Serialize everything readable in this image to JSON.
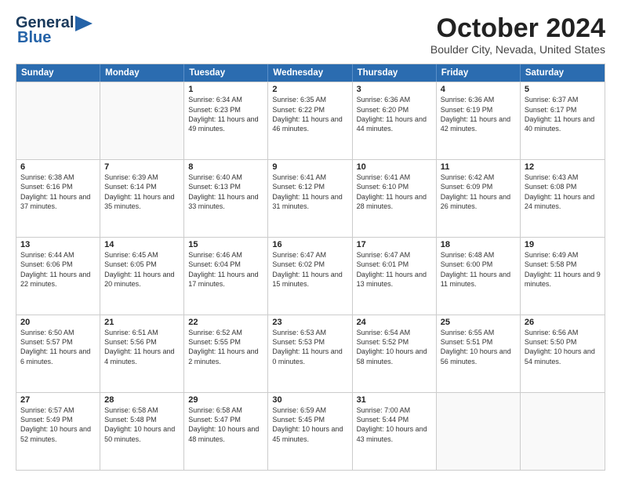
{
  "header": {
    "logo_line1": "General",
    "logo_line2": "Blue",
    "title": "October 2024",
    "location": "Boulder City, Nevada, United States"
  },
  "days_of_week": [
    "Sunday",
    "Monday",
    "Tuesday",
    "Wednesday",
    "Thursday",
    "Friday",
    "Saturday"
  ],
  "weeks": [
    [
      {
        "day": "",
        "sunrise": "",
        "sunset": "",
        "daylight": ""
      },
      {
        "day": "",
        "sunrise": "",
        "sunset": "",
        "daylight": ""
      },
      {
        "day": "1",
        "sunrise": "Sunrise: 6:34 AM",
        "sunset": "Sunset: 6:23 PM",
        "daylight": "Daylight: 11 hours and 49 minutes."
      },
      {
        "day": "2",
        "sunrise": "Sunrise: 6:35 AM",
        "sunset": "Sunset: 6:22 PM",
        "daylight": "Daylight: 11 hours and 46 minutes."
      },
      {
        "day": "3",
        "sunrise": "Sunrise: 6:36 AM",
        "sunset": "Sunset: 6:20 PM",
        "daylight": "Daylight: 11 hours and 44 minutes."
      },
      {
        "day": "4",
        "sunrise": "Sunrise: 6:36 AM",
        "sunset": "Sunset: 6:19 PM",
        "daylight": "Daylight: 11 hours and 42 minutes."
      },
      {
        "day": "5",
        "sunrise": "Sunrise: 6:37 AM",
        "sunset": "Sunset: 6:17 PM",
        "daylight": "Daylight: 11 hours and 40 minutes."
      }
    ],
    [
      {
        "day": "6",
        "sunrise": "Sunrise: 6:38 AM",
        "sunset": "Sunset: 6:16 PM",
        "daylight": "Daylight: 11 hours and 37 minutes."
      },
      {
        "day": "7",
        "sunrise": "Sunrise: 6:39 AM",
        "sunset": "Sunset: 6:14 PM",
        "daylight": "Daylight: 11 hours and 35 minutes."
      },
      {
        "day": "8",
        "sunrise": "Sunrise: 6:40 AM",
        "sunset": "Sunset: 6:13 PM",
        "daylight": "Daylight: 11 hours and 33 minutes."
      },
      {
        "day": "9",
        "sunrise": "Sunrise: 6:41 AM",
        "sunset": "Sunset: 6:12 PM",
        "daylight": "Daylight: 11 hours and 31 minutes."
      },
      {
        "day": "10",
        "sunrise": "Sunrise: 6:41 AM",
        "sunset": "Sunset: 6:10 PM",
        "daylight": "Daylight: 11 hours and 28 minutes."
      },
      {
        "day": "11",
        "sunrise": "Sunrise: 6:42 AM",
        "sunset": "Sunset: 6:09 PM",
        "daylight": "Daylight: 11 hours and 26 minutes."
      },
      {
        "day": "12",
        "sunrise": "Sunrise: 6:43 AM",
        "sunset": "Sunset: 6:08 PM",
        "daylight": "Daylight: 11 hours and 24 minutes."
      }
    ],
    [
      {
        "day": "13",
        "sunrise": "Sunrise: 6:44 AM",
        "sunset": "Sunset: 6:06 PM",
        "daylight": "Daylight: 11 hours and 22 minutes."
      },
      {
        "day": "14",
        "sunrise": "Sunrise: 6:45 AM",
        "sunset": "Sunset: 6:05 PM",
        "daylight": "Daylight: 11 hours and 20 minutes."
      },
      {
        "day": "15",
        "sunrise": "Sunrise: 6:46 AM",
        "sunset": "Sunset: 6:04 PM",
        "daylight": "Daylight: 11 hours and 17 minutes."
      },
      {
        "day": "16",
        "sunrise": "Sunrise: 6:47 AM",
        "sunset": "Sunset: 6:02 PM",
        "daylight": "Daylight: 11 hours and 15 minutes."
      },
      {
        "day": "17",
        "sunrise": "Sunrise: 6:47 AM",
        "sunset": "Sunset: 6:01 PM",
        "daylight": "Daylight: 11 hours and 13 minutes."
      },
      {
        "day": "18",
        "sunrise": "Sunrise: 6:48 AM",
        "sunset": "Sunset: 6:00 PM",
        "daylight": "Daylight: 11 hours and 11 minutes."
      },
      {
        "day": "19",
        "sunrise": "Sunrise: 6:49 AM",
        "sunset": "Sunset: 5:58 PM",
        "daylight": "Daylight: 11 hours and 9 minutes."
      }
    ],
    [
      {
        "day": "20",
        "sunrise": "Sunrise: 6:50 AM",
        "sunset": "Sunset: 5:57 PM",
        "daylight": "Daylight: 11 hours and 6 minutes."
      },
      {
        "day": "21",
        "sunrise": "Sunrise: 6:51 AM",
        "sunset": "Sunset: 5:56 PM",
        "daylight": "Daylight: 11 hours and 4 minutes."
      },
      {
        "day": "22",
        "sunrise": "Sunrise: 6:52 AM",
        "sunset": "Sunset: 5:55 PM",
        "daylight": "Daylight: 11 hours and 2 minutes."
      },
      {
        "day": "23",
        "sunrise": "Sunrise: 6:53 AM",
        "sunset": "Sunset: 5:53 PM",
        "daylight": "Daylight: 11 hours and 0 minutes."
      },
      {
        "day": "24",
        "sunrise": "Sunrise: 6:54 AM",
        "sunset": "Sunset: 5:52 PM",
        "daylight": "Daylight: 10 hours and 58 minutes."
      },
      {
        "day": "25",
        "sunrise": "Sunrise: 6:55 AM",
        "sunset": "Sunset: 5:51 PM",
        "daylight": "Daylight: 10 hours and 56 minutes."
      },
      {
        "day": "26",
        "sunrise": "Sunrise: 6:56 AM",
        "sunset": "Sunset: 5:50 PM",
        "daylight": "Daylight: 10 hours and 54 minutes."
      }
    ],
    [
      {
        "day": "27",
        "sunrise": "Sunrise: 6:57 AM",
        "sunset": "Sunset: 5:49 PM",
        "daylight": "Daylight: 10 hours and 52 minutes."
      },
      {
        "day": "28",
        "sunrise": "Sunrise: 6:58 AM",
        "sunset": "Sunset: 5:48 PM",
        "daylight": "Daylight: 10 hours and 50 minutes."
      },
      {
        "day": "29",
        "sunrise": "Sunrise: 6:58 AM",
        "sunset": "Sunset: 5:47 PM",
        "daylight": "Daylight: 10 hours and 48 minutes."
      },
      {
        "day": "30",
        "sunrise": "Sunrise: 6:59 AM",
        "sunset": "Sunset: 5:45 PM",
        "daylight": "Daylight: 10 hours and 45 minutes."
      },
      {
        "day": "31",
        "sunrise": "Sunrise: 7:00 AM",
        "sunset": "Sunset: 5:44 PM",
        "daylight": "Daylight: 10 hours and 43 minutes."
      },
      {
        "day": "",
        "sunrise": "",
        "sunset": "",
        "daylight": ""
      },
      {
        "day": "",
        "sunrise": "",
        "sunset": "",
        "daylight": ""
      }
    ]
  ]
}
